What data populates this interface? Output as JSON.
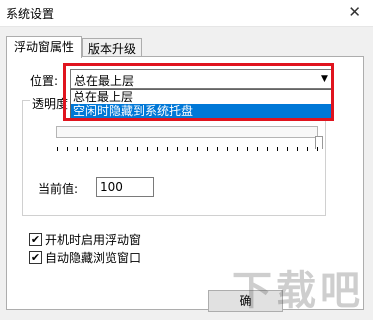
{
  "window": {
    "title": "系统设置",
    "close_symbol": "✕"
  },
  "tabs": [
    {
      "label": "浮动窗属性",
      "active": true
    },
    {
      "label": "版本升级",
      "active": false
    }
  ],
  "position": {
    "label": "位置:",
    "selected": "总在最上层",
    "options": [
      "总在最上层",
      "空闲时隐藏到系统托盘"
    ],
    "highlighted_option": "空闲时隐藏到系统托盘"
  },
  "transparency": {
    "group_label": "透明度",
    "current_label": "当前值:",
    "current_value": "100"
  },
  "checkboxes": [
    {
      "label": "开机时启用浮动窗",
      "checked": true
    },
    {
      "label": "自动隐藏浏览窗口",
      "checked": true
    }
  ],
  "button": {
    "label": "确"
  },
  "watermark": {
    "text": "下载吧"
  },
  "colors": {
    "highlight": "#0078d7",
    "annotation_red": "#e0141e"
  }
}
